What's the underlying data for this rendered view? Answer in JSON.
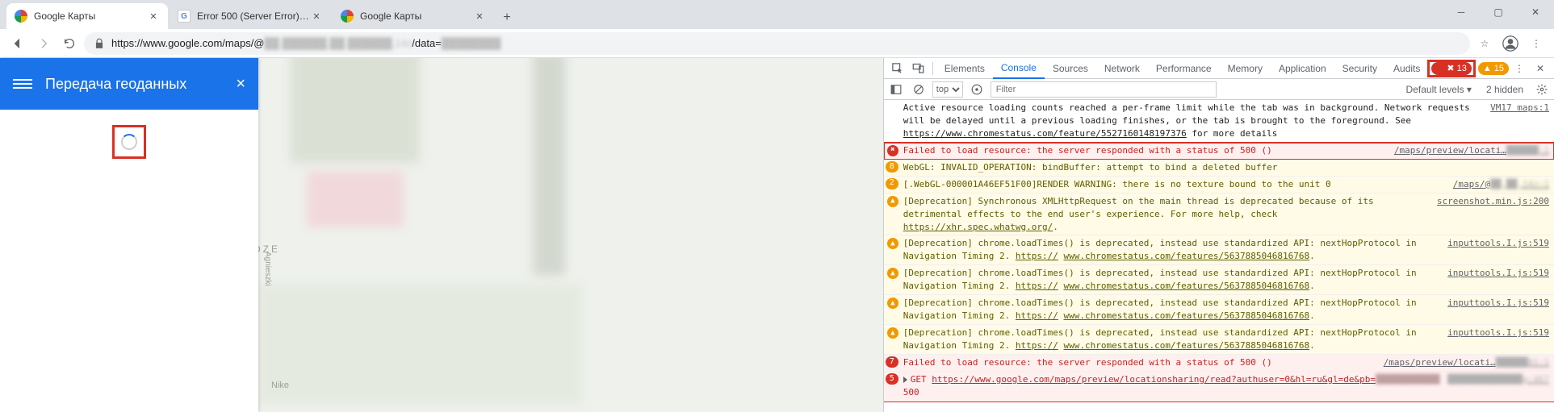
{
  "window": {
    "tabs": [
      {
        "title": "Google Карты",
        "favicon": "gm"
      },
      {
        "title": "Error 500 (Server Error)!!1",
        "favicon": "g"
      },
      {
        "title": "Google Карты",
        "favicon": "gm"
      }
    ]
  },
  "toolbar": {
    "url_prefix": "https://www.google.com/maps/@",
    "url_blur": "██.██████,██.██████,14z",
    "url_mid": "/data=",
    "url_blur2": "████████"
  },
  "maps": {
    "header_title": "Передача геоданных"
  },
  "devtools": {
    "tabs": [
      "Elements",
      "Console",
      "Sources",
      "Network",
      "Performance",
      "Memory",
      "Application",
      "Security",
      "Audits"
    ],
    "active_tab": "Console",
    "error_count": "13",
    "warn_count": "15",
    "filter": {
      "context": "top",
      "placeholder": "Filter",
      "levels": "Default levels ▾",
      "hidden_label": "2 hidden"
    },
    "log": [
      {
        "kind": "info",
        "msg_parts": [
          {
            "t": "Active resource loading counts reached a per-frame limit while the tab was in background. Network requests will be delayed until a previous loading finishes, or the tab is brought to the foreground. See "
          },
          {
            "t": "https://www.chromestatus.com/feature/5527160148197376",
            "link": true
          },
          {
            "t": " for more details"
          }
        ],
        "src": "VM17 maps:1"
      },
      {
        "kind": "error",
        "glyph": "✖",
        "highlight": true,
        "msg_parts": [
          {
            "t": "Failed to load resource: the server responded with a status of 500 ()"
          }
        ],
        "src": "/maps/preview/locati…",
        "src_blur": "██████:1"
      },
      {
        "kind": "warn",
        "count": "8",
        "msg_parts": [
          {
            "t": "WebGL: INVALID_OPERATION: bindBuffer: attempt to bind a deleted buffer"
          }
        ],
        "src": ""
      },
      {
        "kind": "warn",
        "count": "2",
        "msg_parts": [
          {
            "t": "[.WebGL-000001A46EF51F00]RENDER WARNING: there is no texture bound to the unit 0"
          }
        ],
        "src": "/maps/@",
        "src_blur": "██,██,14z:1"
      },
      {
        "kind": "warn",
        "glyph": "▲",
        "msg_parts": [
          {
            "t": "[Deprecation] Synchronous XMLHttpRequest on the main thread is deprecated because of its detrimental effects to the end user's experience. For more help, check "
          },
          {
            "t": "https://xhr.spec.whatwg.org/",
            "link": true
          },
          {
            "t": "."
          }
        ],
        "src": "screenshot.min.js:200"
      },
      {
        "kind": "warn",
        "glyph": "▲",
        "msg_parts": [
          {
            "t": "[Deprecation] chrome.loadTimes() is deprecated, instead use standardized API: nextHopProtocol in Navigation Timing 2. "
          },
          {
            "t": "https://",
            "link": true
          },
          {
            "t": " "
          },
          {
            "t": "www.chromestatus.com/features/5637885046816768",
            "link": true
          },
          {
            "t": "."
          }
        ],
        "src": "inputtools.I.js:519"
      },
      {
        "kind": "warn",
        "glyph": "▲",
        "msg_parts": [
          {
            "t": "[Deprecation] chrome.loadTimes() is deprecated, instead use standardized API: nextHopProtocol in Navigation Timing 2. "
          },
          {
            "t": "https://",
            "link": true
          },
          {
            "t": " "
          },
          {
            "t": "www.chromestatus.com/features/5637885046816768",
            "link": true
          },
          {
            "t": "."
          }
        ],
        "src": "inputtools.I.js:519"
      },
      {
        "kind": "warn",
        "glyph": "▲",
        "msg_parts": [
          {
            "t": "[Deprecation] chrome.loadTimes() is deprecated, instead use standardized API: nextHopProtocol in Navigation Timing 2. "
          },
          {
            "t": "https://",
            "link": true
          },
          {
            "t": " "
          },
          {
            "t": "www.chromestatus.com/features/5637885046816768",
            "link": true
          },
          {
            "t": "."
          }
        ],
        "src": "inputtools.I.js:519"
      },
      {
        "kind": "warn",
        "glyph": "▲",
        "msg_parts": [
          {
            "t": "[Deprecation] chrome.loadTimes() is deprecated, instead use standardized API: nextHopProtocol in Navigation Timing 2. "
          },
          {
            "t": "https://",
            "link": true
          },
          {
            "t": " "
          },
          {
            "t": "www.chromestatus.com/features/5637885046816768",
            "link": true
          },
          {
            "t": "."
          }
        ],
        "src": "inputtools.I.js:519"
      },
      {
        "kind": "error",
        "count": "7",
        "highlight_group": true,
        "msg_parts": [
          {
            "t": "Failed to load resource: the server responded with a status of 500 ()"
          }
        ],
        "src": "/maps/preview/locati…",
        "src_blur": "██████81:1"
      },
      {
        "kind": "error",
        "count": "5",
        "highlight_group": true,
        "expandable": true,
        "msg_parts": [
          {
            "t": "GET "
          },
          {
            "t": "https://www.google.com/maps/preview/locationsharing/read?authuser=0&hl=ru&gl=de&pb=",
            "link": true
          },
          {
            "t": "████████████",
            "blur": true
          },
          {
            "t": " 500"
          }
        ],
        "src": "",
        "src_blur": "██████████████g:467"
      }
    ]
  }
}
